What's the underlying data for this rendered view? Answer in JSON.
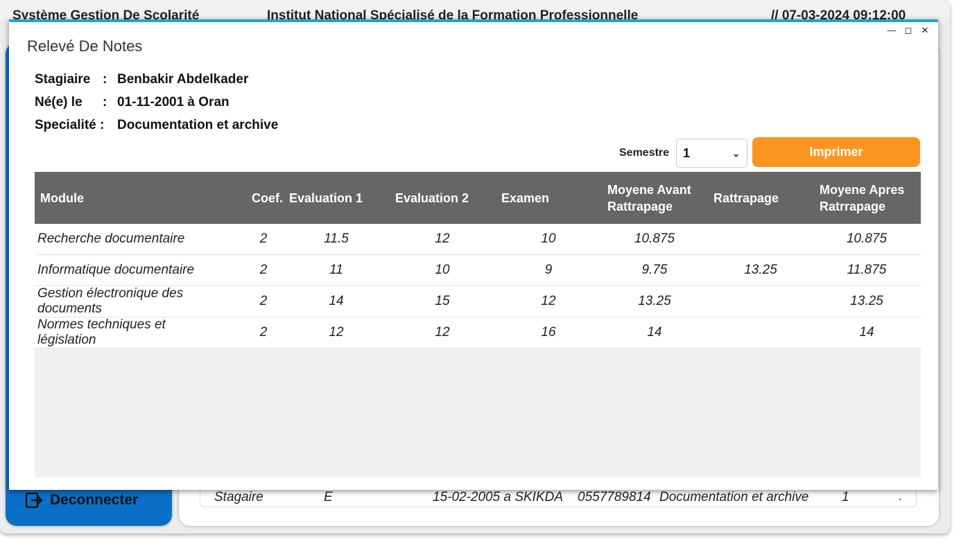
{
  "app": {
    "title_left": "Système Gestion De Scolarité",
    "title_center": "Institut National Spécialisé de la Formation Professionnelle",
    "title_right": "// 07-03-2024 09:12:00",
    "logout_label": "Deconnecter",
    "background_row": {
      "type": "Stagaire",
      "sexe": "E",
      "birth": "15-02-2005 a SKIKDA",
      "phone": "0557789814",
      "speciality": "Documentation et archive",
      "semestre": "1"
    }
  },
  "dialog": {
    "title": "Relevé De Notes",
    "student": {
      "name_label": "Stagiaire",
      "name": "Benbakir Abdelkader",
      "birth_label": "Né(e) le",
      "birth": "01-11-2001 à Oran",
      "speciality_label": "Specialité :",
      "speciality": "Documentation et archive",
      "separator": ":"
    },
    "semestre_label": "Semestre",
    "semestre_value": "1",
    "print_label": "Imprimer",
    "columns": {
      "module": "Module",
      "coef": "Coef.",
      "eval1": "Evaluation 1",
      "eval2": "Evaluation 2",
      "examen": "Examen",
      "moy_avant_1": "Moyene Avant",
      "moy_avant_2": "Rattrapage",
      "rattrapage": "Rattrapage",
      "moy_apres_1": "Moyene Apres",
      "moy_apres_2": "Ratrrapage"
    },
    "rows": [
      {
        "module": "Recherche documentaire",
        "coef": "2",
        "eval1": "11.5",
        "eval2": "12",
        "examen": "10",
        "moy_avant": "10.875",
        "rattrapage": "",
        "moy_apres": "10.875"
      },
      {
        "module": "Informatique documentaire",
        "coef": "2",
        "eval1": "11",
        "eval2": "10",
        "examen": "9",
        "moy_avant": "9.75",
        "rattrapage": "13.25",
        "moy_apres": "11.875"
      },
      {
        "module": "Gestion électronique des documents",
        "coef": "2",
        "eval1": "14",
        "eval2": "15",
        "examen": "12",
        "moy_avant": "13.25",
        "rattrapage": "",
        "moy_apres": "13.25"
      },
      {
        "module": "Normes techniques et législation",
        "coef": "2",
        "eval1": "12",
        "eval2": "12",
        "examen": "16",
        "moy_avant": "14",
        "rattrapage": "",
        "moy_apres": "14"
      }
    ],
    "colors": {
      "accent": "#1aa6d6",
      "print_button": "#fb951f",
      "header": "#666666",
      "sidebar": "#0a6fc7"
    }
  }
}
